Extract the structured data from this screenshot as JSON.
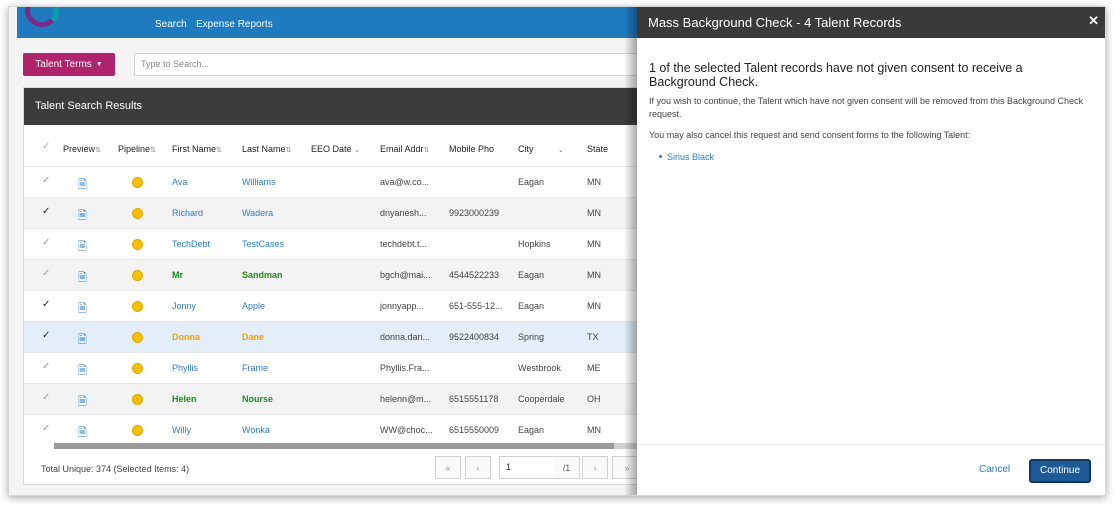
{
  "nav": {
    "search": "Search",
    "expense_reports": "Expense Reports"
  },
  "toolbar": {
    "terms_label": "Talent Terms",
    "search_placeholder": "Type to Search..."
  },
  "panel": {
    "title": "Talent Search Results"
  },
  "columns": [
    "Preview",
    "Pipeline",
    "First Name",
    "Last Name",
    "EEO Date",
    "Email Addr",
    "Mobile Pho",
    "City",
    "State"
  ],
  "rows": [
    {
      "checked": false,
      "first": "Ava",
      "last": "Williams",
      "email": "ava@w.co...",
      "phone": "",
      "city": "Eagan",
      "state": "MN",
      "style": "blue"
    },
    {
      "checked": true,
      "first": "Richard",
      "last": "Wadera",
      "email": "dnyanesh...",
      "phone": "9923000239",
      "city": "",
      "state": "MN",
      "style": "blue"
    },
    {
      "checked": false,
      "first": "TechDebt",
      "last": "TestCases",
      "email": "techdebt.t...",
      "phone": "",
      "city": "Hopkins",
      "state": "MN",
      "style": "blue"
    },
    {
      "checked": false,
      "first": "Mr",
      "last": "Sandman",
      "email": "bgch@mai...",
      "phone": "4544522233",
      "city": "Eagan",
      "state": "MN",
      "style": "green"
    },
    {
      "checked": true,
      "first": "Jonny",
      "last": "Apple",
      "email": "jonnyapp...",
      "phone": "651-555-12...",
      "city": "Eagan",
      "state": "MN",
      "style": "blue"
    },
    {
      "checked": true,
      "first": "Donna",
      "last": "Dane",
      "email": "donna.dan...",
      "phone": "9522400834",
      "city": "Spring",
      "state": "TX",
      "style": "orange"
    },
    {
      "checked": false,
      "first": "Phyllis",
      "last": "Frame",
      "email": "Phyllis.Fra...",
      "phone": "",
      "city": "Westbrook",
      "state": "ME",
      "style": "blue"
    },
    {
      "checked": false,
      "first": "Helen",
      "last": "Nourse",
      "email": "helenn@m...",
      "phone": "6515551178",
      "city": "Cooperdale",
      "state": "OH",
      "style": "green"
    },
    {
      "checked": false,
      "first": "Willy",
      "last": "Wonka",
      "email": "WW@choc...",
      "phone": "6515550009",
      "city": "Eagan",
      "state": "MN",
      "style": "blue"
    }
  ],
  "footer": {
    "total": "Total Unique: 374 (Selected Items: 4)",
    "page_value": "1",
    "page_total": "/1"
  },
  "modal": {
    "title": "Mass Background Check - 4 Talent Records",
    "headline": "1 of the selected Talent records have not given consent to receive a Background Check.",
    "body1": "If you wish to continue, the Talent which have not given consent will be removed from this Background Check request.",
    "body2": "You may also cancel this request and send consent forms to the following Talent:",
    "talent": "Sirius Black",
    "cancel": "Cancel",
    "continue": "Continue"
  },
  "colors": {
    "primary": "#1f7bc0",
    "accent": "#b0246b",
    "header_dark": "#3c3c3c",
    "button": "#1d5a96"
  }
}
